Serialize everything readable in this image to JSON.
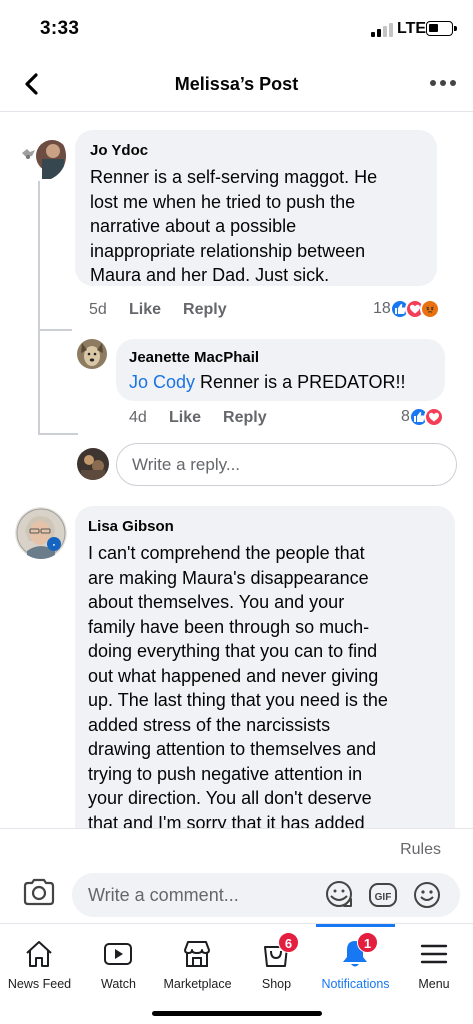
{
  "status_bar": {
    "time": "3:33",
    "network": "LTE"
  },
  "header": {
    "title": "Melissa’s Post"
  },
  "comments": [
    {
      "author": "Jo Ydoc",
      "text_lines": [
        "Renner is a self-serving maggot.  He",
        "lost me when he tried to push the",
        "narrative about a possible",
        "inappropriate relationship between",
        "Maura and her Dad.  Just sick."
      ],
      "time": "5d",
      "like_label": "Like",
      "reply_label": "Reply",
      "reaction_count": "18",
      "reactions": [
        "like-icon",
        "love-icon",
        "angry-icon"
      ],
      "replies": [
        {
          "author": "Jeanette MacPhail",
          "mention": "Jo Cody",
          "text": " Renner is a PREDATOR!!",
          "time": "4d",
          "like_label": "Like",
          "reply_label": "Reply",
          "reaction_count": "8",
          "reactions": [
            "like-icon",
            "love-icon"
          ]
        }
      ],
      "reply_placeholder": "Write a reply..."
    },
    {
      "author": "Lisa Gibson",
      "text_lines": [
        "I can't comprehend the people that",
        "are making Maura's disappearance",
        "about themselves.  You and your",
        "family have been through so much-",
        "doing everything that you can to find",
        "out what happened and never giving",
        "up.  The last thing that you need is the",
        "added stress of the narcissists",
        "drawing attention to themselves and",
        "trying to push negative attention in",
        "your direction.  You all don't deserve",
        "that and I'm sorry that it has added"
      ]
    }
  ],
  "composer": {
    "rules_label": "Rules",
    "placeholder": "Write a comment..."
  },
  "tabs": [
    {
      "label": "News Feed",
      "icon": "home-icon"
    },
    {
      "label": "Watch",
      "icon": "video-icon"
    },
    {
      "label": "Marketplace",
      "icon": "store-icon"
    },
    {
      "label": "Shop",
      "icon": "shop-icon",
      "badge": "6"
    },
    {
      "label": "Notifications",
      "icon": "bell-icon",
      "badge": "1",
      "active": true
    },
    {
      "label": "Menu",
      "icon": "menu-icon"
    }
  ],
  "colors": {
    "accent": "#1877f2",
    "badge": "#e41e3f",
    "bubble": "#f0f2f5",
    "muted": "#65676b"
  }
}
